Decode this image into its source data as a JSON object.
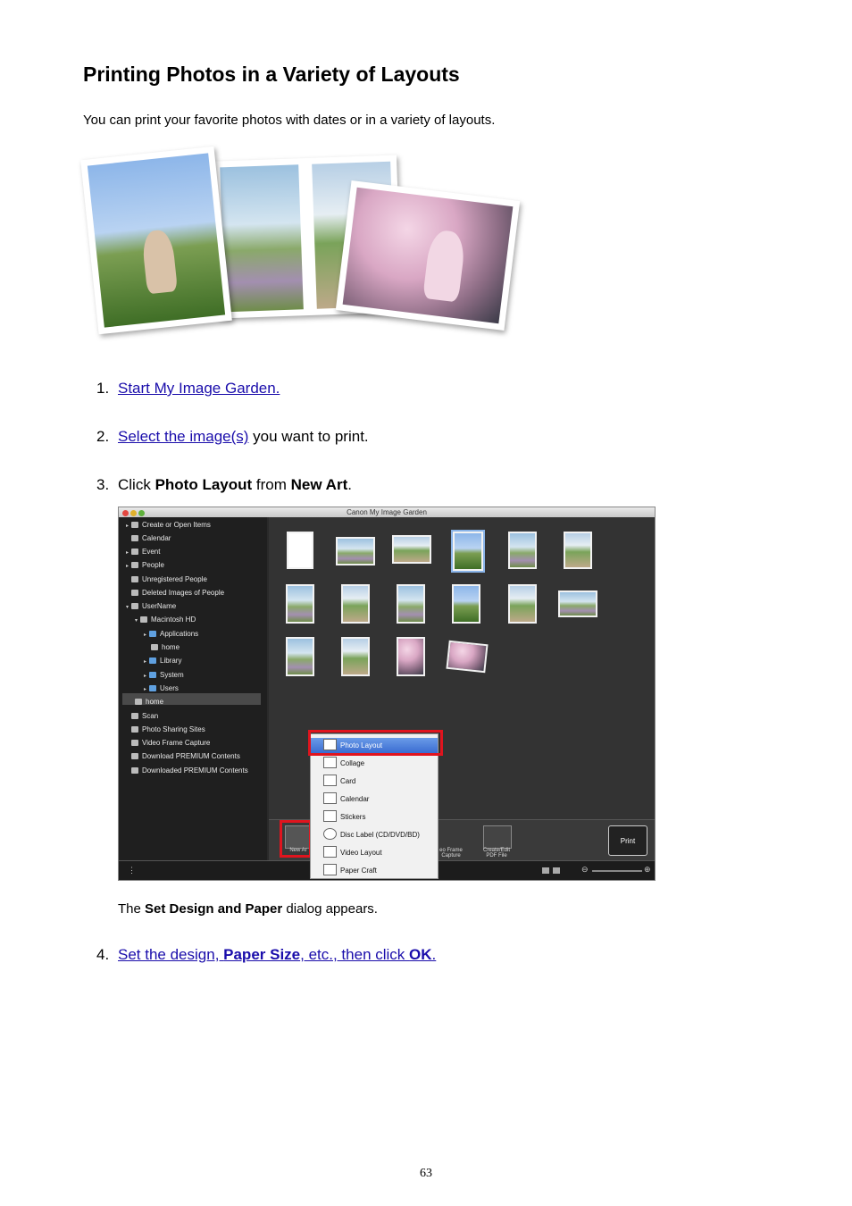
{
  "page": {
    "title": "Printing Photos in a Variety of Layouts",
    "intro": "You can print your favorite photos with dates or in a variety of layouts.",
    "page_number": "63"
  },
  "steps": [
    {
      "num": "1.",
      "link": "Start My Image Garden."
    },
    {
      "num": "2.",
      "link": "Select the image(s)",
      "rest": " you want to print."
    },
    {
      "num": "3.",
      "pre": "Click ",
      "b1": "Photo Layout",
      "mid": " from ",
      "b2": "New Art",
      "post": "."
    },
    {
      "num": "4.",
      "l1": "Set the design, ",
      "lb1": "Paper Size",
      "l2": ", etc., then click ",
      "lb2": "OK",
      "l3": "."
    }
  ],
  "caption": {
    "pre": "The ",
    "bold": "Set Design and Paper",
    "post": " dialog appears."
  },
  "app": {
    "window_title": "Canon My Image Garden",
    "sidebar": [
      {
        "label": "Create or Open Items"
      },
      {
        "label": "Calendar"
      },
      {
        "label": "Event"
      },
      {
        "label": "People"
      },
      {
        "label": "Unregistered People"
      },
      {
        "label": "Deleted Images of People"
      },
      {
        "label": "UserName"
      },
      {
        "label": "Macintosh HD"
      },
      {
        "label": "Applications"
      },
      {
        "label": "home"
      },
      {
        "label": "Library"
      },
      {
        "label": "System"
      },
      {
        "label": "Users"
      },
      {
        "label": "home"
      },
      {
        "label": "Scan"
      },
      {
        "label": "Photo Sharing Sites"
      },
      {
        "label": "Video Frame Capture"
      },
      {
        "label": "Download PREMIUM Contents"
      },
      {
        "label": "Downloaded PREMIUM Contents"
      }
    ],
    "menu": [
      {
        "label": "Photo Layout"
      },
      {
        "label": "Collage"
      },
      {
        "label": "Card"
      },
      {
        "label": "Calendar"
      },
      {
        "label": "Stickers"
      },
      {
        "label": "Disc Label (CD/DVD/BD)"
      },
      {
        "label": "Video Layout"
      },
      {
        "label": "Paper Craft"
      }
    ],
    "toolbar": {
      "new_art": "New Ar",
      "video_frame_1": "eo Frame",
      "video_frame_2": "Capture",
      "pdf_1": "Create/Edit",
      "pdf_2": "PDF File",
      "print": "Print"
    },
    "colors": {
      "highlight": "#e0141e",
      "menu_selected": "#3769d0"
    }
  }
}
